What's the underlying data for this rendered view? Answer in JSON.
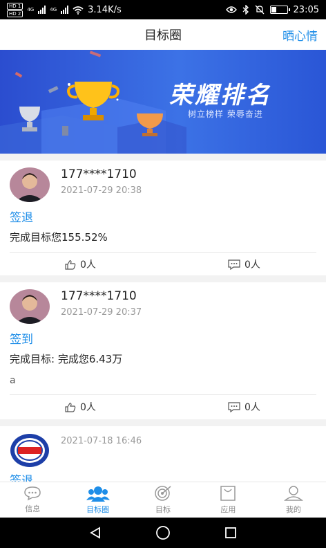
{
  "status_bar": {
    "sim1": "HD 1",
    "sim2": "HD 2",
    "net1": "4G",
    "net2": "4G",
    "speed": "3.14K/s",
    "time": "23:05",
    "battery_level": 0.35
  },
  "header": {
    "title": "目标圈",
    "share_label": "晒心情"
  },
  "banner": {
    "title": "荣耀排名",
    "subtitle": "树立榜样  荣辱奋进"
  },
  "posts": [
    {
      "user": "177****1710",
      "time": "2021-07-29 20:38",
      "checkin": "签退",
      "content": "完成目标您155.52%",
      "note": "",
      "likes": "0人",
      "comments": "0人"
    },
    {
      "user": "177****1710",
      "time": "2021-07-29 20:37",
      "checkin": "签到",
      "content": "完成目标: 完成您6.43万",
      "note": "a",
      "likes": "0人",
      "comments": "0人"
    },
    {
      "user": "",
      "time": "2021-07-18 16:46",
      "checkin": "签退",
      "content": "",
      "note": ""
    }
  ],
  "tabbar": [
    {
      "label": "信息",
      "icon": "chat-bubble-icon",
      "active": false
    },
    {
      "label": "目标圈",
      "icon": "group-icon",
      "active": true
    },
    {
      "label": "目标",
      "icon": "target-icon",
      "active": false
    },
    {
      "label": "应用",
      "icon": "bag-icon",
      "active": false
    },
    {
      "label": "我的",
      "icon": "user-icon",
      "active": false
    }
  ],
  "colors": {
    "accent": "#1f8ee8",
    "banner": "#3c72e6"
  }
}
